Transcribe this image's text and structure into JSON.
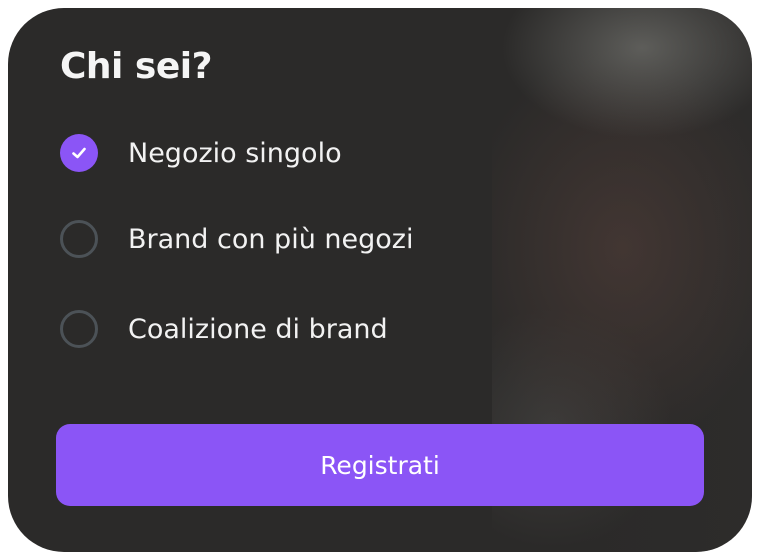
{
  "dialog": {
    "title": "Chi sei?",
    "options": [
      {
        "label": "Negozio singolo",
        "selected": true
      },
      {
        "label": "Brand con più negozi",
        "selected": false
      },
      {
        "label": "Coalizione di brand",
        "selected": false
      }
    ],
    "submit_label": "Registrati"
  },
  "colors": {
    "accent": "#8b55f6",
    "card_background": "#2b2a29",
    "radio_border": "#4c5257",
    "text": "#f2f2f2"
  },
  "icons": {
    "selected_option": "check-icon"
  }
}
